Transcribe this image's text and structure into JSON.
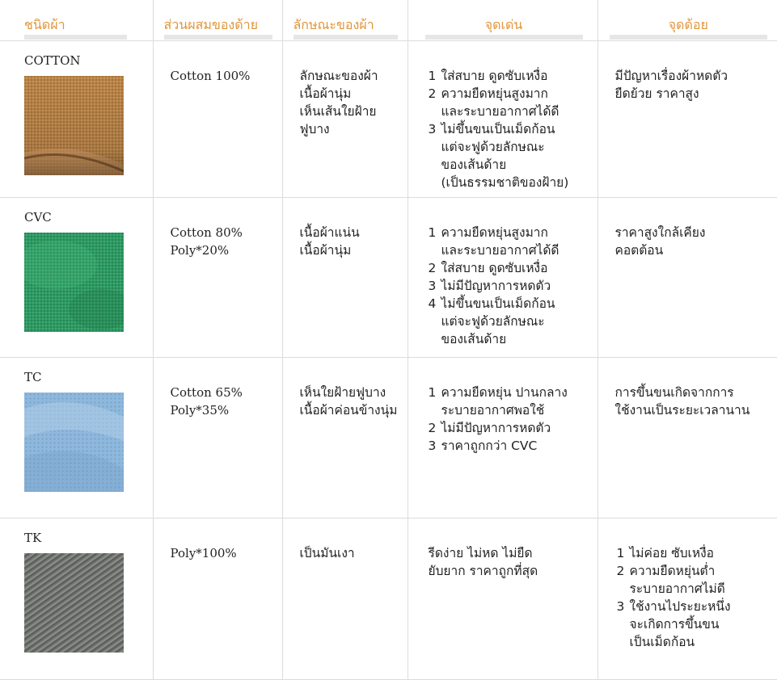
{
  "header": {
    "fabric_type": "ชนิดผ้า",
    "composition": "ส่วนผสมของด้าย",
    "characteristics": "ลักษณะของผ้า",
    "pros": "จุดเด่น",
    "cons": "จุดด้อย"
  },
  "rows": [
    {
      "name": "COTTON",
      "swatch_color": "#b9854a",
      "composition": [
        "Cotton 100%"
      ],
      "characteristics": [
        "ลักษณะของผ้า",
        "เนื้อผ้านุ่ม",
        "เห็นเส้นใยฝ้าย",
        "ฟูบาง"
      ],
      "pros": [
        {
          "num": "1",
          "lines": [
            "ใส่สบาย ดูดซับเหงื่อ"
          ]
        },
        {
          "num": "2",
          "lines": [
            "ความยืดหยุ่นสูงมาก",
            "และระบายอากาศได้ดี"
          ]
        },
        {
          "num": "3",
          "lines": [
            "ไม่ขึ้นขนเป็นเม็ดก้อน",
            "แต่จะฟูด้วยลักษณะ",
            "ของเส้นด้าย",
            "(เป็นธรรมชาติของฝ้าย)"
          ]
        }
      ],
      "cons": [
        "มีปัญหาเรื่องผ้าหดตัว",
        "ยืดย้วย ราคาสูง"
      ]
    },
    {
      "name": "CVC",
      "swatch_color": "#2f9a63",
      "composition": [
        "Cotton 80%",
        "Poly*20%"
      ],
      "characteristics": [
        "เนื้อผ้าแน่น",
        "เนื้อผ้านุ่ม"
      ],
      "pros": [
        {
          "num": "1",
          "lines": [
            "ความยืดหยุ่นสูงมาก",
            "และระบายอากาศได้ดี"
          ]
        },
        {
          "num": "2",
          "lines": [
            "ใส่สบาย ดูดซับเหงื่อ"
          ]
        },
        {
          "num": "3",
          "lines": [
            "ไม่มีปัญหาการหดตัว"
          ]
        },
        {
          "num": "4",
          "lines": [
            "ไม่ขึ้นขนเป็นเม็ดก้อน",
            "แต่จะฟูด้วยลักษณะ",
            "ของเส้นด้าย"
          ]
        }
      ],
      "cons": [
        "ราคาสูงใกล้เคียง",
        "คอตต้อน"
      ]
    },
    {
      "name": "TC",
      "swatch_color": "#8fb8dc",
      "composition": [
        "Cotton 65%",
        "Poly*35%"
      ],
      "characteristics": [
        "เห็นใยฝ้ายฟูบาง",
        "เนื้อผ้าค่อนข้างนุ่ม"
      ],
      "pros": [
        {
          "num": "1",
          "lines": [
            "ความยืดหยุ่น ปานกลาง",
            "ระบายอากาศพอใช้"
          ]
        },
        {
          "num": "2",
          "lines": [
            "ไม่มีปัญหาการหดตัว"
          ]
        },
        {
          "num": "3",
          "lines": [
            "ราคาถูกกว่า CVC"
          ]
        }
      ],
      "cons": [
        "การขึ้นขนเกิดจากการ",
        "ใช้งานเป็นระยะเวลานาน"
      ]
    },
    {
      "name": "TK",
      "swatch_color": "#6d706c",
      "composition": [
        "Poly*100%"
      ],
      "characteristics": [
        "เป็นมันเงา"
      ],
      "pros_plain": [
        "รีดง่าย ไม่หด ไม่ยืด",
        "ยับยาก ราคาถูกที่สุด"
      ],
      "cons_list": [
        {
          "num": "1",
          "lines": [
            "ไม่ค่อย ซับเหงื่อ"
          ]
        },
        {
          "num": "2",
          "lines": [
            "ความยืดหยุ่นต่ำ",
            "ระบายอากาศไม่ดี"
          ]
        },
        {
          "num": "3",
          "lines": [
            "ใช้งานไประยะหนึ่ง",
            "จะเกิดการขึ้นขน",
            "เป็นเม็ดก้อน"
          ]
        }
      ]
    }
  ]
}
